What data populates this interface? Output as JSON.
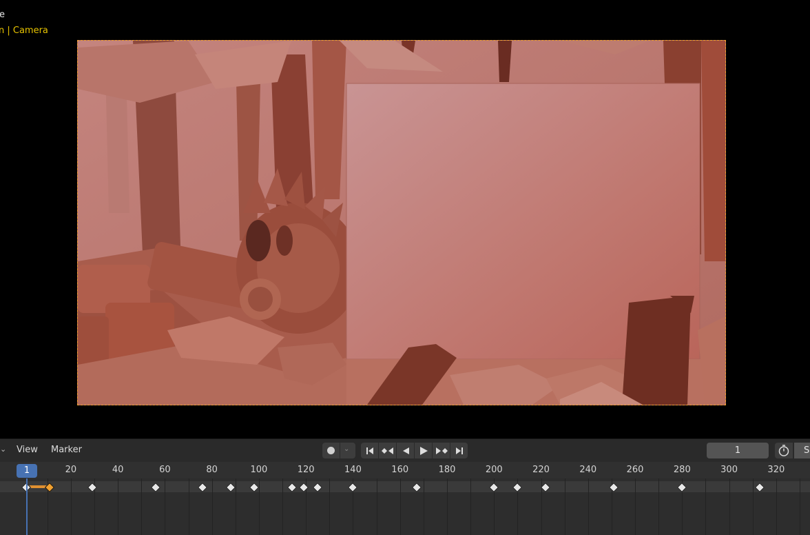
{
  "viewport": {
    "overlay_line1": "e",
    "overlay_line2": "n | Camera"
  },
  "timeline": {
    "menus": [
      "View",
      "Marker"
    ],
    "current_frame": "1",
    "start_label": "S",
    "ruler_ticks": [
      "20",
      "40",
      "60",
      "80",
      "100",
      "120",
      "140",
      "160",
      "180",
      "200",
      "220",
      "240",
      "260",
      "280",
      "300",
      "320"
    ],
    "keyframes": [
      1,
      11,
      29,
      56,
      76,
      88,
      98,
      114,
      119,
      125,
      140,
      167,
      200,
      210,
      222,
      251,
      280,
      313
    ],
    "selected_keyframes": [
      11
    ],
    "hold_range": [
      1,
      11
    ]
  },
  "icons": {
    "record": "record-dot-icon",
    "jump_start": "jump-to-start-icon",
    "prev_key": "previous-keyframe-icon",
    "play_reverse": "play-reverse-icon",
    "play": "play-icon",
    "next_key": "next-keyframe-icon",
    "jump_end": "jump-to-end-icon",
    "stopwatch": "stopwatch-icon"
  },
  "colors": {
    "accent": "#4772b3",
    "camera_border": "#f0a030",
    "overlay_camera_text": "#e7c300",
    "keyframe_selected": "#f0a030"
  }
}
